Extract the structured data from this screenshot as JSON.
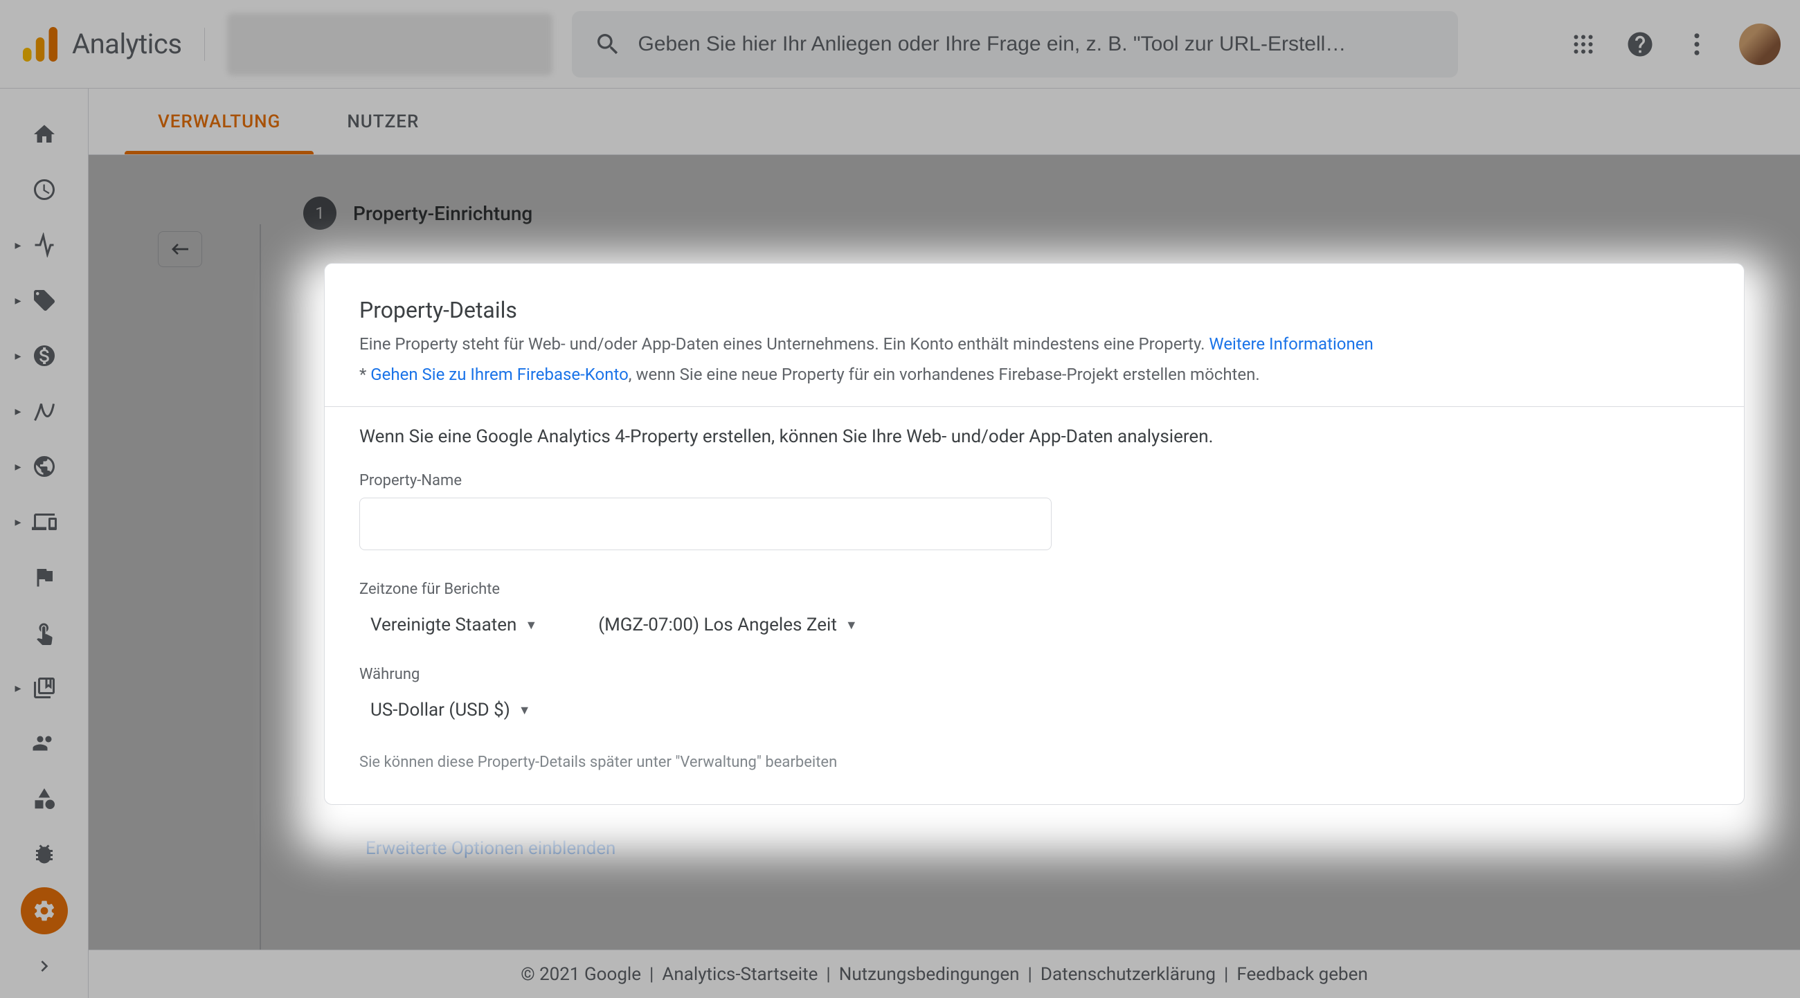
{
  "header": {
    "product": "Analytics",
    "search_placeholder": "Geben Sie hier Ihr Anliegen oder Ihre Frage ein, z. B. \"Tool zur URL-Erstell…"
  },
  "tabs": {
    "admin": "VERWALTUNG",
    "users": "NUTZER"
  },
  "step": {
    "number": "1",
    "title": "Property-Einrichtung"
  },
  "card": {
    "heading": "Property-Details",
    "desc1_a": "Eine Property steht für Web- und/oder App-Daten eines Unternehmens. Ein Konto enthält mindestens eine Property. ",
    "desc1_link": "Weitere Informationen",
    "desc2_prefix": "* ",
    "desc2_link": "Gehen Sie zu Ihrem Firebase-Konto",
    "desc2_suffix": ", wenn Sie eine neue Property für ein vorhandenes Firebase-Projekt erstellen möchten.",
    "ga4_text": "Wenn Sie eine Google Analytics 4-Property erstellen, können Sie Ihre Web- und/oder App-Daten analysieren.",
    "name_label": "Property-Name",
    "tz_label": "Zeitzone für Berichte",
    "tz_country": "Vereinigte Staaten",
    "tz_zone": "(MGZ-07:00) Los Angeles Zeit",
    "currency_label": "Währung",
    "currency_value": "US-Dollar (USD $)",
    "hint": "Sie können diese Property-Details später unter \"Verwaltung\" bearbeiten"
  },
  "advanced": "Erweiterte Optionen einblenden",
  "footer": {
    "copyright": "© 2021 Google",
    "home": "Analytics-Startseite",
    "terms": "Nutzungsbedingungen",
    "privacy": "Datenschutzerklärung",
    "feedback": "Feedback geben"
  }
}
